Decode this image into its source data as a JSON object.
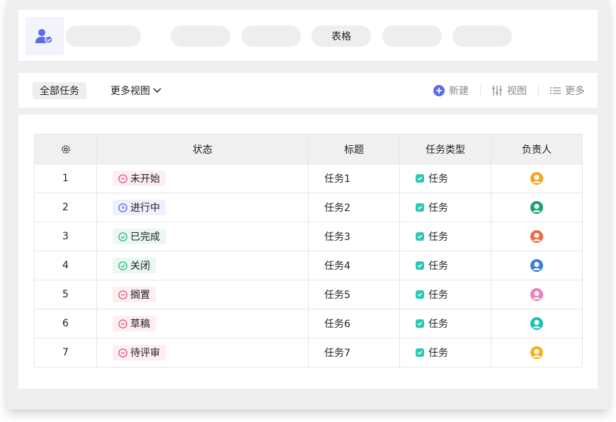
{
  "topbar": {
    "tabs": [
      {
        "label": ""
      },
      {
        "label": ""
      },
      {
        "label": ""
      },
      {
        "label": "表格"
      },
      {
        "label": ""
      },
      {
        "label": ""
      }
    ]
  },
  "toolbar": {
    "all_tasks": "全部任务",
    "more_views": "更多视图",
    "new_label": "新建",
    "view_label": "视图",
    "more_label": "更多",
    "accent": "#5b6bea"
  },
  "table": {
    "headers": {
      "settings_icon": "gear-icon",
      "status": "状态",
      "title": "标题",
      "type": "任务类型",
      "owner": "负责人"
    },
    "rows": [
      {
        "num": "1",
        "status": "未开始",
        "status_icon": "minus-circle-icon",
        "status_color": "#e0557a",
        "status_bg": "#fdeef2",
        "title": "任务1",
        "type": "任务",
        "owner_color": "#f5a623"
      },
      {
        "num": "2",
        "status": "进行中",
        "status_icon": "clock-circle-icon",
        "status_color": "#5b6bea",
        "status_bg": "#eef0fd",
        "title": "任务2",
        "type": "任务",
        "owner_color": "#1aa36b"
      },
      {
        "num": "3",
        "status": "已完成",
        "status_icon": "check-circle-icon",
        "status_color": "#2fb57d",
        "status_bg": "#e9f8f1",
        "title": "任务3",
        "type": "任务",
        "owner_color": "#f06a3f"
      },
      {
        "num": "4",
        "status": "关闭",
        "status_icon": "check-circle-icon",
        "status_color": "#2fb57d",
        "status_bg": "#e9f8f1",
        "title": "任务4",
        "type": "任务",
        "owner_color": "#3b7ddd"
      },
      {
        "num": "5",
        "status": "搁置",
        "status_icon": "minus-circle-icon",
        "status_color": "#e0557a",
        "status_bg": "#fdeef2",
        "title": "任务5",
        "type": "任务",
        "owner_color": "#ec7fb9"
      },
      {
        "num": "6",
        "status": "草稿",
        "status_icon": "minus-circle-icon",
        "status_color": "#e0557a",
        "status_bg": "#fdeef2",
        "title": "任务6",
        "type": "任务",
        "owner_color": "#17c1b4"
      },
      {
        "num": "7",
        "status": "待评审",
        "status_icon": "minus-circle-icon",
        "status_color": "#e0557a",
        "status_bg": "#fdeef2",
        "title": "任务7",
        "type": "任务",
        "owner_color": "#f5b21d"
      }
    ]
  }
}
